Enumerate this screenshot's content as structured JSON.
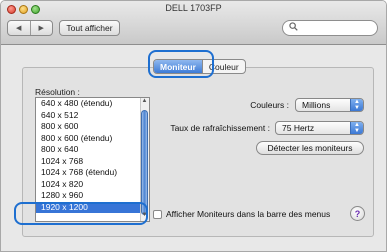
{
  "window": {
    "title": "DELL 1703FP",
    "controls": [
      "close",
      "minimize",
      "zoom"
    ]
  },
  "toolbar": {
    "back_icon": "back-arrow-icon",
    "forward_icon": "forward-arrow-icon",
    "back_glyph": "◀",
    "forward_glyph": "▶",
    "show_all_label": "Tout afficher",
    "search_icon": "magnifier-icon",
    "search_glyph": "🔍",
    "search_value": ""
  },
  "tabs": [
    {
      "label": "Moniteur",
      "active": true
    },
    {
      "label": "Couleur",
      "active": false
    }
  ],
  "resolution": {
    "label": "Résolution :",
    "items": [
      "640 x 480 (étendu)",
      "640 x 512",
      "800 x 600",
      "800 x 600 (étendu)",
      "800 x 640",
      "1024 x 768",
      "1024 x 768 (étendu)",
      "1024 x 820",
      "1280 x 960",
      "1920 x 1200"
    ],
    "selected": "1920 x 1200"
  },
  "settings": {
    "colors_label": "Couleurs :",
    "colors_value": "Millions",
    "refresh_label": "Taux de rafraîchissement :",
    "refresh_value": "75 Hertz",
    "detect_label": "Détecter les moniteurs",
    "menu_bar_checkbox_label": "Afficher Moniteurs dans la barre des menus",
    "menu_bar_checked": false,
    "help_label": "?"
  },
  "colors": {
    "accent": "#3875d7",
    "highlight_outline": "#1e6fd0"
  }
}
